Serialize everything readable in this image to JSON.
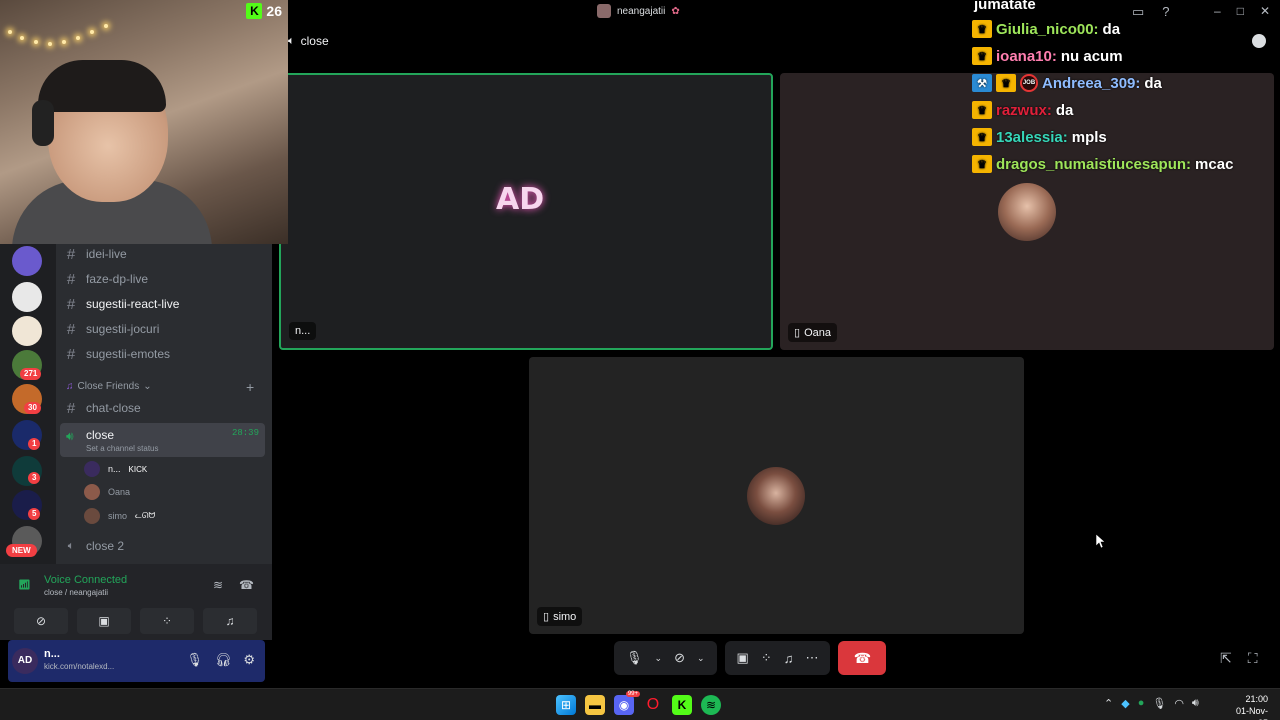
{
  "webcam": {
    "kick_count": "26"
  },
  "window": {
    "call_title": "neangajatii"
  },
  "header": {
    "channel_name": "close"
  },
  "chat": {
    "top_partial": "jumatate",
    "lines": [
      {
        "user": "Giulia_nico00:",
        "msg": "da",
        "color": "#9ee55a",
        "badges": [
          "crown"
        ]
      },
      {
        "user": "ioana10:",
        "msg": "nu acum",
        "color": "#ff7fb0",
        "badges": [
          "crown"
        ]
      },
      {
        "user": "Andreea_309:",
        "msg": "da",
        "color": "#8fbcff",
        "badges": [
          "mod",
          "crown",
          "jm"
        ]
      },
      {
        "user": "razwux:",
        "msg": "da",
        "color": "#e0203a",
        "badges": [
          "crown"
        ]
      },
      {
        "user": "13alessia:",
        "msg": "mpls",
        "color": "#36d6b8",
        "badges": [
          "crown"
        ]
      },
      {
        "user": "dragos_numaistiucesapun:",
        "msg": "mcac",
        "color": "#9ee55a",
        "badges": [
          "crown"
        ]
      }
    ],
    "jm_badge_text": "JOB"
  },
  "rail": {
    "badges": [
      "271",
      "30",
      "1",
      "3",
      "5"
    ],
    "new_label": "NEW"
  },
  "channels": {
    "text": [
      {
        "name": "idei-live"
      },
      {
        "name": "faze-dp-live"
      },
      {
        "name": "sugestii-react-live"
      },
      {
        "name": "sugestii-jocuri"
      },
      {
        "name": "sugestii-emotes"
      }
    ],
    "category": "Close Friends",
    "chat_close": "chat-close",
    "voice_active": {
      "name": "close",
      "status": "Set a channel status",
      "time": "28:39"
    },
    "members": [
      {
        "name": "n...",
        "tag": "KICK"
      },
      {
        "name": "Oana",
        "tag": ""
      },
      {
        "name": "simo",
        "tag": "ᓚᘏᗢ"
      }
    ],
    "voice_other": "close 2"
  },
  "voice_panel": {
    "connected": "Voice Connected",
    "location": "close / neangajatii"
  },
  "user_panel": {
    "name": "n...",
    "status": "kick.com/notalexd..."
  },
  "tiles": [
    {
      "label": "n..."
    },
    {
      "label": "Oana"
    },
    {
      "label": "simo"
    }
  ],
  "taskbar": {
    "time": "21:00",
    "date": "01-Nov-25",
    "opera_badge": "99+"
  },
  "colors": {
    "accent_green": "#23a55a",
    "hangup_red": "#da373c",
    "kick_green": "#53fc18"
  }
}
